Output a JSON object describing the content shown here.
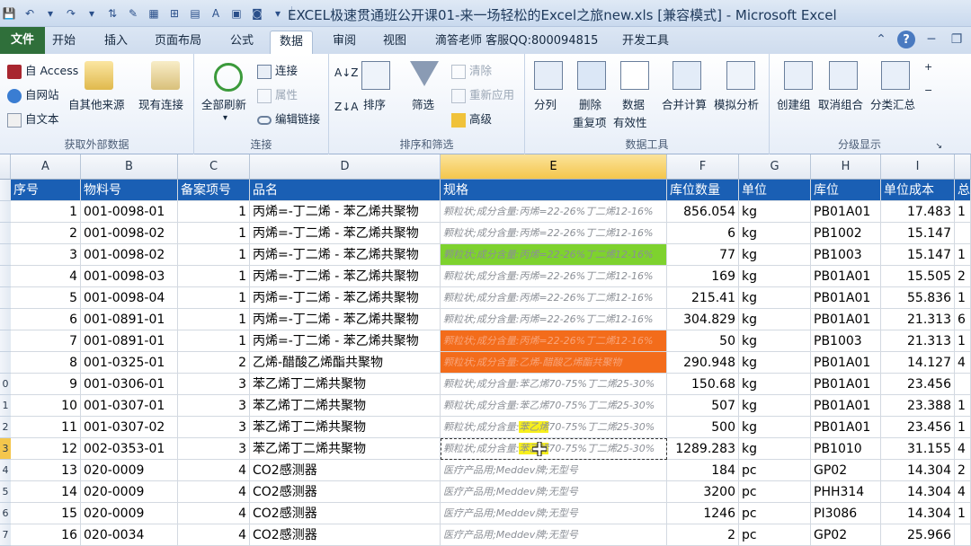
{
  "window": {
    "title": "EXCEL极速贯通班公开课01-来一场轻松的Excel之旅new.xls  [兼容模式]  -  Microsoft Excel"
  },
  "ribbon": {
    "tabs": [
      "文件",
      "开始",
      "插入",
      "页面布局",
      "公式",
      "数据",
      "审阅",
      "视图",
      "滴答老师 客服QQ:800094815",
      "开发工具"
    ],
    "active_tab": "数据",
    "groups": {
      "external": {
        "label": "获取外部数据",
        "access": "自 Access",
        "web": "自网站",
        "text": "自文本",
        "other": "自其他来源",
        "existing": "现有连接"
      },
      "connections": {
        "label": "连接",
        "refresh_all": "全部刷新",
        "connections": "连接",
        "properties": "属性",
        "edit_links": "编辑链接"
      },
      "sort_filter": {
        "label": "排序和筛选",
        "sort": "排序",
        "filter": "筛选",
        "clear": "清除",
        "reapply": "重新应用",
        "advanced": "高级"
      },
      "data_tools": {
        "label": "数据工具",
        "split": "分列",
        "remove_dup_1": "删除",
        "remove_dup_2": "重复项",
        "validation_1": "数据",
        "validation_2": "有效性",
        "consolidate": "合并计算",
        "what_if": "模拟分析"
      },
      "outline": {
        "label": "分级显示",
        "group": "创建组",
        "ungroup": "取消组合",
        "subtotal": "分类汇总"
      }
    }
  },
  "sheet": {
    "columns": [
      "A",
      "B",
      "C",
      "D",
      "E",
      "F",
      "G",
      "H",
      "I"
    ],
    "selected_column": "E",
    "header_row": [
      "序号",
      "物料号",
      "备案项号",
      "品名",
      "规格",
      "库位数量",
      "单位",
      "库位",
      "单位成本",
      "总"
    ],
    "row_labels": [
      "",
      "",
      "",
      "",
      "",
      "",
      "",
      "",
      "0",
      "1",
      "2",
      "3",
      "4",
      "5",
      "6",
      "7"
    ],
    "selected_row_label": "3",
    "rows": [
      [
        "1",
        "001-0098-01",
        "1",
        "丙烯=-丁二烯 - 苯乙烯共聚物",
        "颗粒状;成分含量:丙烯=22-26%丁二烯12-16%",
        "856.054",
        "kg",
        "PB01A01",
        "17.483",
        "1"
      ],
      [
        "2",
        "001-0098-02",
        "1",
        "丙烯=-丁二烯 - 苯乙烯共聚物",
        "颗粒状;成分含量:丙烯=22-26%丁二烯12-16%",
        "6",
        "kg",
        "PB1002",
        "15.147",
        ""
      ],
      [
        "3",
        "001-0098-02",
        "1",
        "丙烯=-丁二烯 - 苯乙烯共聚物",
        "颗粒状;成分含量:丙烯=22-26%丁二烯12-16%",
        "77",
        "kg",
        "PB1003",
        "15.147",
        "1"
      ],
      [
        "4",
        "001-0098-03",
        "1",
        "丙烯=-丁二烯 - 苯乙烯共聚物",
        "颗粒状;成分含量:丙烯=22-26%丁二烯12-16%",
        "169",
        "kg",
        "PB01A01",
        "15.505",
        "2"
      ],
      [
        "5",
        "001-0098-04",
        "1",
        "丙烯=-丁二烯 - 苯乙烯共聚物",
        "颗粒状;成分含量:丙烯=22-26%丁二烯12-16%",
        "215.41",
        "kg",
        "PB01A01",
        "55.836",
        "1"
      ],
      [
        "6",
        "001-0891-01",
        "1",
        "丙烯=-丁二烯 - 苯乙烯共聚物",
        "颗粒状;成分含量:丙烯=22-26%丁二烯12-16%",
        "304.829",
        "kg",
        "PB01A01",
        "21.313",
        "6"
      ],
      [
        "7",
        "001-0891-01",
        "1",
        "丙烯=-丁二烯 - 苯乙烯共聚物",
        "颗粒状;成分含量:丙烯=22-26%丁二烯12-16%",
        "50",
        "kg",
        "PB1003",
        "21.313",
        "1"
      ],
      [
        "8",
        "001-0325-01",
        "2",
        "乙烯-醋酸乙烯酯共聚物",
        "颗粒状;成分含量:乙烯-醋酸乙烯酯共聚物",
        "290.948",
        "kg",
        "PB01A01",
        "14.127",
        "4"
      ],
      [
        "9",
        "001-0306-01",
        "3",
        "苯乙烯丁二烯共聚物",
        "颗粒状;成分含量:苯乙烯70-75%丁二烯25-30%",
        "150.68",
        "kg",
        "PB01A01",
        "23.456",
        ""
      ],
      [
        "10",
        "001-0307-01",
        "3",
        "苯乙烯丁二烯共聚物",
        "颗粒状;成分含量:苯乙烯70-75%丁二烯25-30%",
        "507",
        "kg",
        "PB01A01",
        "23.388",
        "1"
      ],
      [
        "11",
        "001-0307-02",
        "3",
        "苯乙烯丁二烯共聚物",
        "颗粒状;成分含量:苯乙烯70-75%丁二烯25-30%",
        "500",
        "kg",
        "PB01A01",
        "23.456",
        "1"
      ],
      [
        "12",
        "002-0353-01",
        "3",
        "苯乙烯丁二烯共聚物",
        "颗粒状;成分含量:苯乙烯70-75%丁二烯25-30%",
        "1289.283",
        "kg",
        "PB1010",
        "31.155",
        "4"
      ],
      [
        "13",
        "020-0009",
        "4",
        "CO2感测器",
        "医疗产品用;Meddev牌;无型号",
        "184",
        "pc",
        "GP02",
        "14.304",
        "2"
      ],
      [
        "14",
        "020-0009",
        "4",
        "CO2感测器",
        "医疗产品用;Meddev牌;无型号",
        "3200",
        "pc",
        "PHH314",
        "14.304",
        "4"
      ],
      [
        "15",
        "020-0009",
        "4",
        "CO2感测器",
        "医疗产品用;Meddev牌;无型号",
        "1246",
        "pc",
        "PI3086",
        "14.304",
        "1"
      ],
      [
        "16",
        "020-0034",
        "4",
        "CO2感测器",
        "医疗产品用;Meddev牌;无型号",
        "2",
        "pc",
        "GP02",
        "25.966",
        ""
      ]
    ]
  },
  "colors": {
    "header_fill": "#1a5fb4",
    "green_fill": "#7ed22e",
    "orange_fill": "#f36c1b",
    "yellow_highlight": "#f7ef1c",
    "file_tab": "#2f6f3a"
  }
}
